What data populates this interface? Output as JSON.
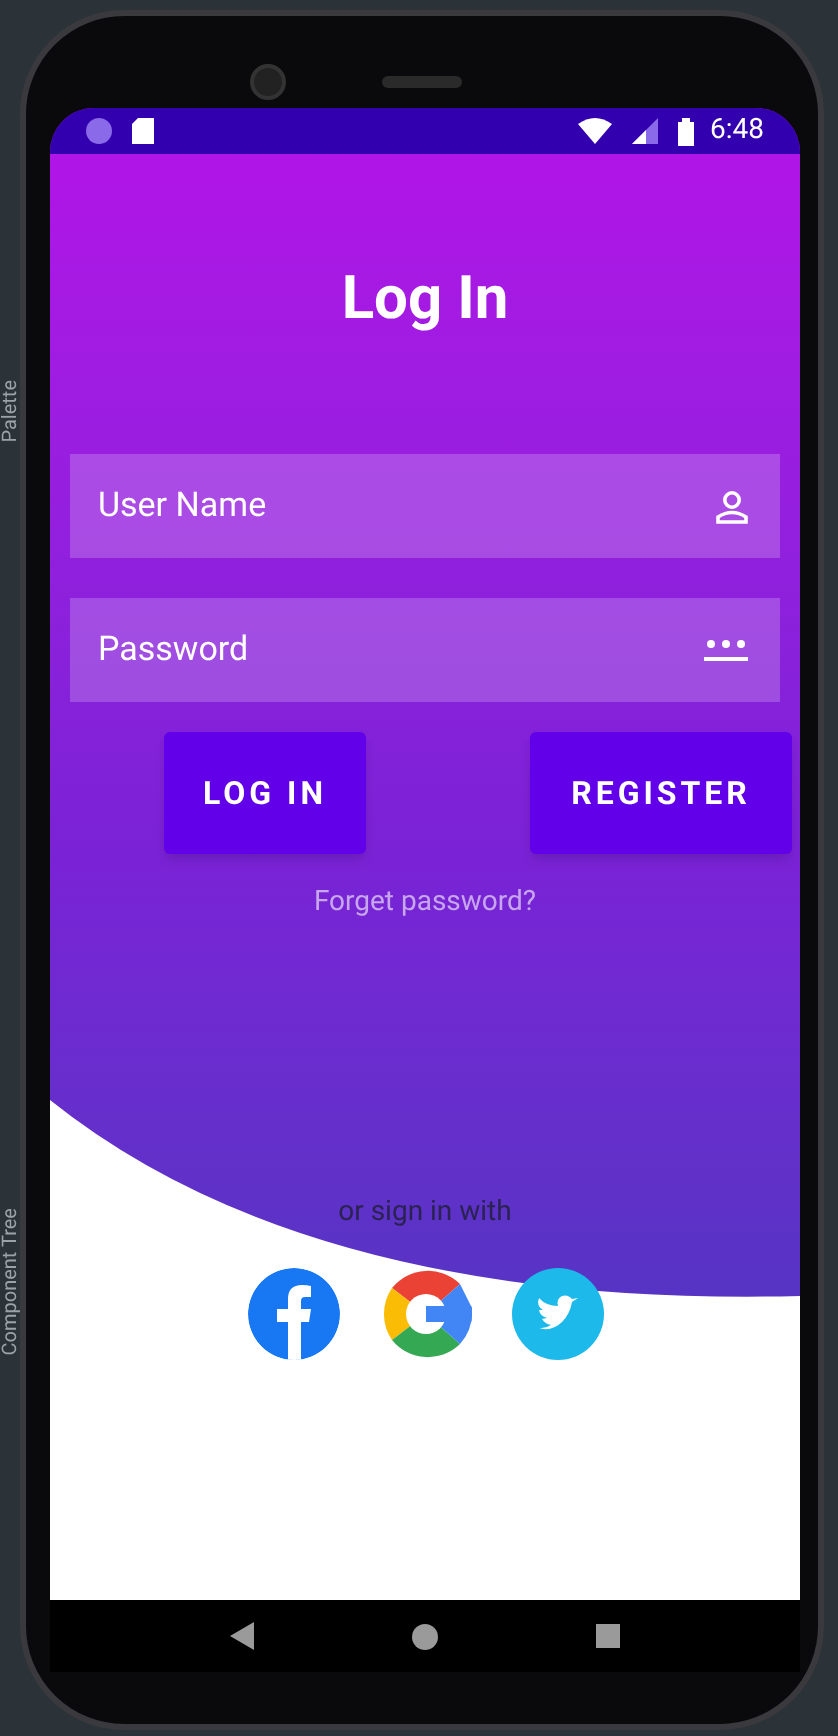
{
  "ide_panels": [
    {
      "label": "Palette"
    },
    {
      "label": "Component Tree"
    }
  ],
  "status_bar": {
    "time": "6:48"
  },
  "title": "Log In",
  "fields": [
    {
      "kind": "user",
      "placeholder": "User Name"
    },
    {
      "kind": "password",
      "placeholder": "Password"
    }
  ],
  "buttons": [
    "LOG IN",
    "REGISTER"
  ],
  "forgot_link": "Forget password?",
  "social": {
    "label": "or sign in with",
    "providers": [
      {
        "kind": "facebook"
      },
      {
        "kind": "google"
      },
      {
        "kind": "twitter"
      }
    ]
  }
}
